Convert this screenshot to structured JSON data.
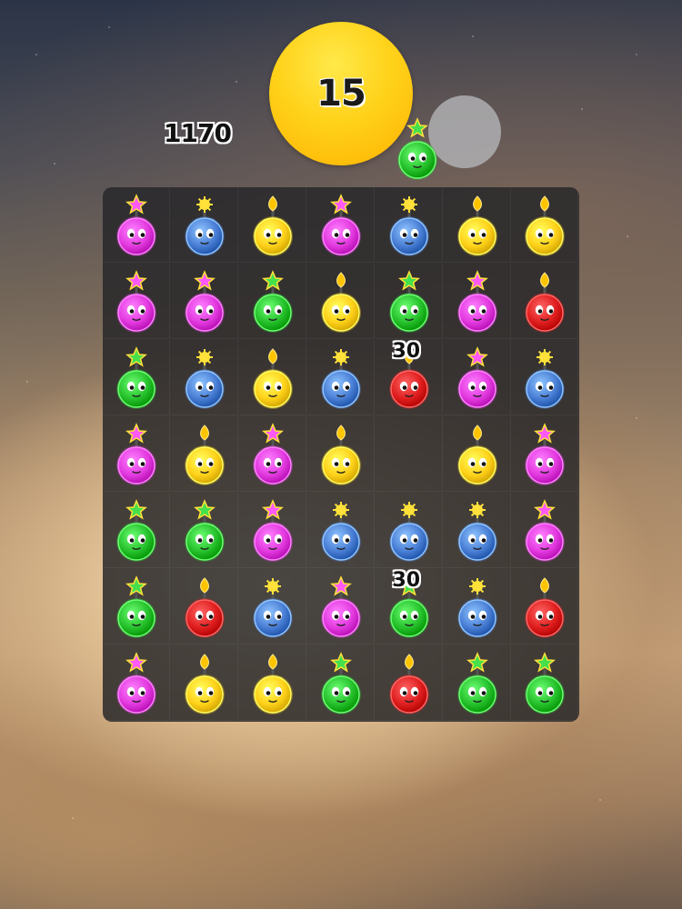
{
  "hud": {
    "timer": "15",
    "score": "1170",
    "timer_color": "#ffc400"
  },
  "colors": {
    "pink": "#e33be0",
    "blue": "#4a7fd6",
    "yellow": "#ffd21a",
    "green": "#27c22d",
    "red": "#e01f1f"
  },
  "board": {
    "rows": [
      [
        {
          "color": "pink",
          "fuse": "star"
        },
        {
          "color": "blue",
          "fuse": "spark"
        },
        {
          "color": "yellow",
          "fuse": "flame"
        },
        {
          "color": "pink",
          "fuse": "star"
        },
        {
          "color": "blue",
          "fuse": "spark"
        },
        {
          "color": "yellow",
          "fuse": "flame"
        },
        {
          "color": "yellow",
          "fuse": "flame"
        }
      ],
      [
        {
          "color": "pink",
          "fuse": "star"
        },
        {
          "color": "pink",
          "fuse": "star"
        },
        {
          "color": "green",
          "fuse": "star"
        },
        {
          "color": "yellow",
          "fuse": "flame"
        },
        {
          "color": "green",
          "fuse": "star"
        },
        {
          "color": "pink",
          "fuse": "star"
        },
        {
          "color": "red",
          "fuse": "flame"
        }
      ],
      [
        {
          "color": "green",
          "fuse": "star"
        },
        {
          "color": "blue",
          "fuse": "spark"
        },
        {
          "color": "yellow",
          "fuse": "flame"
        },
        {
          "color": "blue",
          "fuse": "spark"
        },
        {
          "color": "red",
          "fuse": "flame"
        },
        {
          "color": "pink",
          "fuse": "star"
        },
        {
          "color": "blue",
          "fuse": "spark"
        }
      ],
      [
        {
          "color": "pink",
          "fuse": "star"
        },
        {
          "color": "yellow",
          "fuse": "flame"
        },
        {
          "color": "pink",
          "fuse": "star"
        },
        {
          "color": "yellow",
          "fuse": "flame"
        },
        null,
        {
          "color": "yellow",
          "fuse": "flame"
        },
        {
          "color": "pink",
          "fuse": "star"
        }
      ],
      [
        {
          "color": "green",
          "fuse": "star"
        },
        {
          "color": "green",
          "fuse": "star"
        },
        {
          "color": "pink",
          "fuse": "star"
        },
        {
          "color": "blue",
          "fuse": "spark"
        },
        {
          "color": "blue",
          "fuse": "spark"
        },
        {
          "color": "blue",
          "fuse": "spark"
        },
        {
          "color": "pink",
          "fuse": "star"
        }
      ],
      [
        {
          "color": "green",
          "fuse": "star"
        },
        {
          "color": "red",
          "fuse": "flame"
        },
        {
          "color": "blue",
          "fuse": "spark"
        },
        {
          "color": "pink",
          "fuse": "star"
        },
        {
          "color": "green",
          "fuse": "star"
        },
        {
          "color": "blue",
          "fuse": "spark"
        },
        {
          "color": "red",
          "fuse": "flame"
        }
      ],
      [
        {
          "color": "pink",
          "fuse": "star"
        },
        {
          "color": "yellow",
          "fuse": "flame"
        },
        {
          "color": "yellow",
          "fuse": "flame"
        },
        {
          "color": "green",
          "fuse": "star"
        },
        {
          "color": "red",
          "fuse": "flame"
        },
        {
          "color": "green",
          "fuse": "star"
        },
        {
          "color": "green",
          "fuse": "star"
        }
      ]
    ]
  },
  "falling_piece": {
    "color": "green",
    "fuse": "star",
    "column": 5
  },
  "float_scores": [
    {
      "text": "30",
      "row": 2,
      "col": 5
    },
    {
      "text": "30",
      "row": 5,
      "col": 5
    }
  ]
}
